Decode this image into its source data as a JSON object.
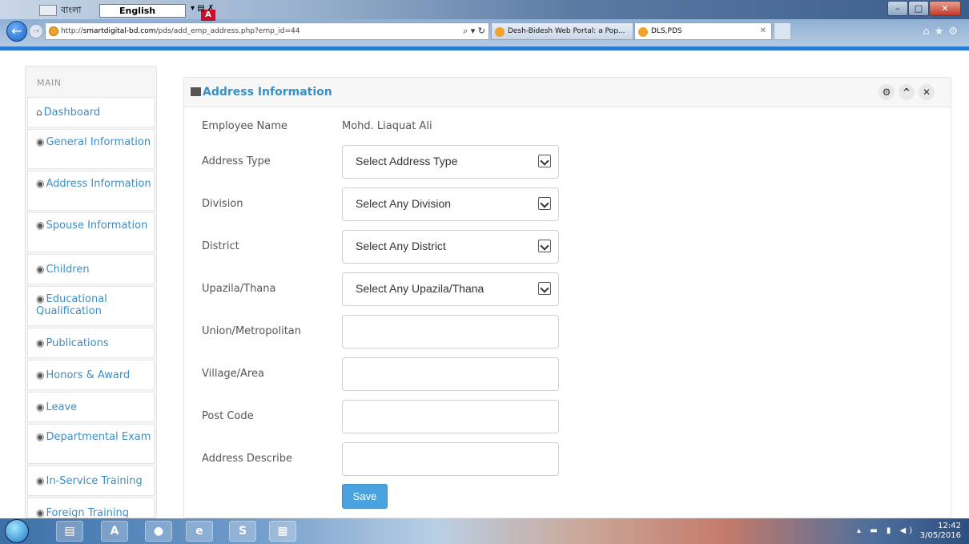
{
  "language_bar": {
    "bengali_label": "বাংলা",
    "language": "English"
  },
  "browser": {
    "url_prefix": "http://",
    "url_host": "smartdigital-bd.com",
    "url_path": "/pds/add_emp_address.php?emp_id=44",
    "addr_tools": "⌕ ▾ ↻",
    "tabs": [
      {
        "label": "Desh-Bidesh Web Portal: a Pop..."
      },
      {
        "label": "DLS,PDS"
      }
    ]
  },
  "sidebar": {
    "heading": "MAIN",
    "items": [
      {
        "label": "Dashboard",
        "icon": "home-icon"
      },
      {
        "label": "General Information",
        "icon": "eye-icon"
      },
      {
        "label": "Address Information",
        "icon": "eye-icon"
      },
      {
        "label": "Spouse Information",
        "icon": "eye-icon"
      },
      {
        "label": "Children",
        "icon": "eye-icon"
      },
      {
        "label": "Educational Qualification",
        "icon": "eye-icon"
      },
      {
        "label": "Publications",
        "icon": "eye-icon"
      },
      {
        "label": "Honors & Award",
        "icon": "eye-icon"
      },
      {
        "label": "Leave",
        "icon": "eye-icon"
      },
      {
        "label": "Departmental Exam",
        "icon": "eye-icon"
      },
      {
        "label": "In-Service Training",
        "icon": "eye-icon"
      },
      {
        "label": "Foreign Training",
        "icon": "eye-icon"
      }
    ]
  },
  "panel": {
    "title": "Address Information",
    "controls": [
      "gear-icon",
      "chevron-up-icon",
      "close-icon"
    ]
  },
  "form": {
    "employee_name_label": "Employee Name",
    "employee_name_value": "Mohd. Liaquat Ali",
    "address_type_label": "Address Type",
    "address_type_value": "Select Address Type",
    "division_label": "Division",
    "division_value": "Select Any Division",
    "district_label": "District",
    "district_value": "Select Any District",
    "upazila_label": "Upazila/Thana",
    "upazila_value": "Select Any Upazila/Thana",
    "union_label": "Union/Metropolitan",
    "union_value": "",
    "village_label": "Village/Area",
    "village_value": "",
    "postcode_label": "Post Code",
    "postcode_value": "",
    "describe_label": "Address Describe",
    "describe_value": "",
    "save_label": "Save"
  },
  "taskbar": {
    "clock_time": "12:42",
    "clock_date": "3/05/2016"
  },
  "colors": {
    "accent": "#3a8fc7",
    "save_button": "#4aa3df"
  }
}
